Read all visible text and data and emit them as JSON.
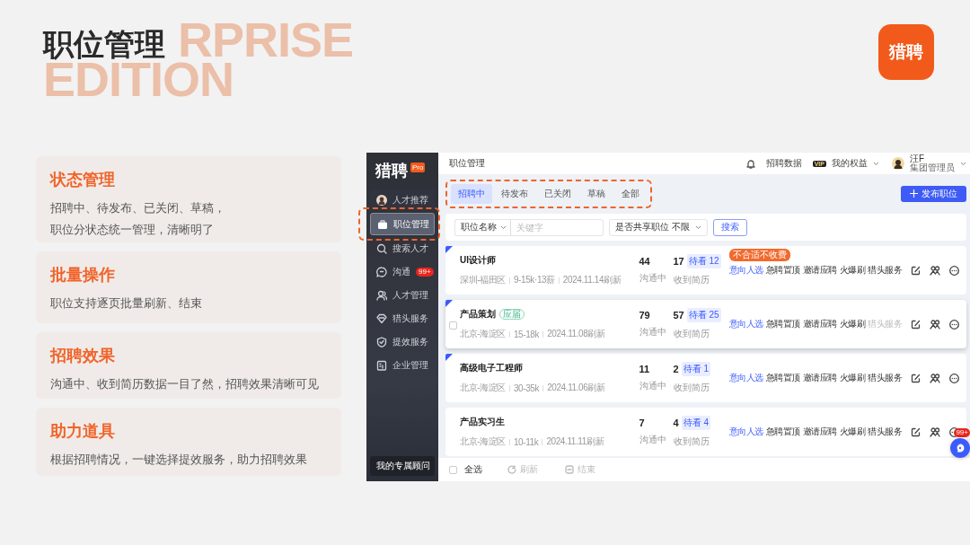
{
  "slide": {
    "title": "职位管理",
    "backdrop": [
      "RPRISE",
      "EDITION"
    ],
    "logo": "猎聘"
  },
  "features": [
    {
      "title": "状态管理",
      "lines": [
        "招聘中、待发布、已关闭、草稿，",
        "职位分状态统一管理，清晰明了"
      ]
    },
    {
      "title": "批量操作",
      "lines": [
        "职位支持逐页批量刷新、结束"
      ]
    },
    {
      "title": "招聘效果",
      "lines": [
        "沟通中、收到简历数据一目了然，招聘效果清晰可见"
      ]
    },
    {
      "title": "助力道具",
      "lines": [
        "根据招聘情况，一键选择提效服务，助力招聘效果"
      ]
    }
  ],
  "app": {
    "sidebar": {
      "brand": "猎聘",
      "brand_badge": "Pro",
      "items": [
        {
          "label": "人才推荐",
          "selected": false,
          "highlighted": false
        },
        {
          "label": "职位管理",
          "selected": true,
          "highlighted": true
        },
        {
          "label": "搜索人才",
          "selected": false,
          "highlighted": false
        },
        {
          "label": "沟通",
          "badge": "99+",
          "selected": false,
          "highlighted": false
        },
        {
          "label": "人才管理",
          "selected": false,
          "highlighted": false
        },
        {
          "label": "猎头服务",
          "selected": false,
          "highlighted": false
        },
        {
          "label": "提效服务",
          "selected": false,
          "highlighted": false
        },
        {
          "label": "企业管理",
          "selected": false,
          "highlighted": false
        }
      ],
      "advisor": "我的专属顾问"
    },
    "topbar": {
      "title": "职位管理",
      "data_link": "招聘数据",
      "vip_badge": "VIP",
      "benefits": "我的权益",
      "user_name": "汪F",
      "user_role": "集团管理员"
    },
    "tabs": [
      {
        "label": "招聘中",
        "selected": true
      },
      {
        "label": "待发布",
        "selected": false
      },
      {
        "label": "已关闭",
        "selected": false
      },
      {
        "label": "草稿",
        "selected": false
      },
      {
        "label": "全部",
        "selected": false
      }
    ],
    "tabs_highlighted": true,
    "publish_button": "发布职位",
    "filter": {
      "field_select": "职位名称",
      "placeholder": "关键字",
      "share_select": "是否共享职位 不限",
      "search_button": "搜索"
    },
    "jobs": [
      {
        "title": "UI设计师",
        "promo_tag": "不合适不收费",
        "meta": [
          "深圳-福田区",
          "9-15k·13薪",
          "2024.11.14刷新"
        ],
        "chatting": "44",
        "chatting_label": "沟通中",
        "resumes": "17",
        "unread": "待看 12",
        "resumes_label": "收到简历",
        "flagged": true,
        "hovered": false,
        "actions": [
          {
            "label": "意向人选",
            "kind": "primary",
            "disabled": false
          },
          {
            "label": "急聘置顶",
            "kind": "plain",
            "disabled": false
          },
          {
            "label": "邀请应聘",
            "kind": "plain",
            "disabled": false
          },
          {
            "label": "火爆刷",
            "kind": "plain",
            "disabled": false
          },
          {
            "label": "猎头服务",
            "kind": "plain",
            "disabled": false
          }
        ]
      },
      {
        "title": "产品策划",
        "title_tag": "应届",
        "meta": [
          "北京-海淀区",
          "15-18k",
          "2024.11.08刷新"
        ],
        "chatting": "79",
        "chatting_label": "沟通中",
        "resumes": "57",
        "unread": "待看 25",
        "resumes_label": "收到简历",
        "flagged": true,
        "hovered": true,
        "checked": false,
        "actions": [
          {
            "label": "意向人选",
            "kind": "primary",
            "disabled": false
          },
          {
            "label": "急聘置顶",
            "kind": "plain",
            "disabled": false
          },
          {
            "label": "邀请应聘",
            "kind": "plain",
            "disabled": false
          },
          {
            "label": "火爆刷",
            "kind": "plain",
            "disabled": false
          },
          {
            "label": "猎头服务",
            "kind": "plain",
            "disabled": true
          }
        ]
      },
      {
        "title": "高级电子工程师",
        "meta": [
          "北京-海淀区",
          "30-35k",
          "2024.11.06刷新"
        ],
        "chatting": "11",
        "chatting_label": "沟通中",
        "resumes": "2",
        "unread": "待看 1",
        "resumes_label": "收到简历",
        "flagged": true,
        "hovered": false,
        "actions": [
          {
            "label": "意向人选",
            "kind": "primary",
            "disabled": false
          },
          {
            "label": "急聘置顶",
            "kind": "plain",
            "disabled": false
          },
          {
            "label": "邀请应聘",
            "kind": "plain",
            "disabled": false
          },
          {
            "label": "火爆刷",
            "kind": "plain",
            "disabled": false
          },
          {
            "label": "猎头服务",
            "kind": "plain",
            "disabled": false
          }
        ]
      },
      {
        "title": "产品实习生",
        "meta": [
          "北京-海淀区",
          "10-11k",
          "2024.11.11刷新"
        ],
        "chatting": "7",
        "chatting_label": "沟通中",
        "resumes": "4",
        "unread": "待看 4",
        "resumes_label": "收到简历",
        "flagged": false,
        "hovered": false,
        "actions": [
          {
            "label": "意向人选",
            "kind": "primary",
            "disabled": false
          },
          {
            "label": "急聘置顶",
            "kind": "plain",
            "disabled": false
          },
          {
            "label": "邀请应聘",
            "kind": "plain",
            "disabled": false
          },
          {
            "label": "火爆刷",
            "kind": "plain",
            "disabled": false
          },
          {
            "label": "猎头服务",
            "kind": "plain",
            "disabled": false
          }
        ]
      }
    ],
    "footer": {
      "select_all": "全选",
      "select_all_checked": false,
      "actions": [
        {
          "label": "刷新",
          "kind": "refresh",
          "disabled": true
        },
        {
          "label": "结束",
          "kind": "end",
          "disabled": true
        }
      ]
    },
    "chat_fab": {
      "badge": "99+"
    }
  }
}
